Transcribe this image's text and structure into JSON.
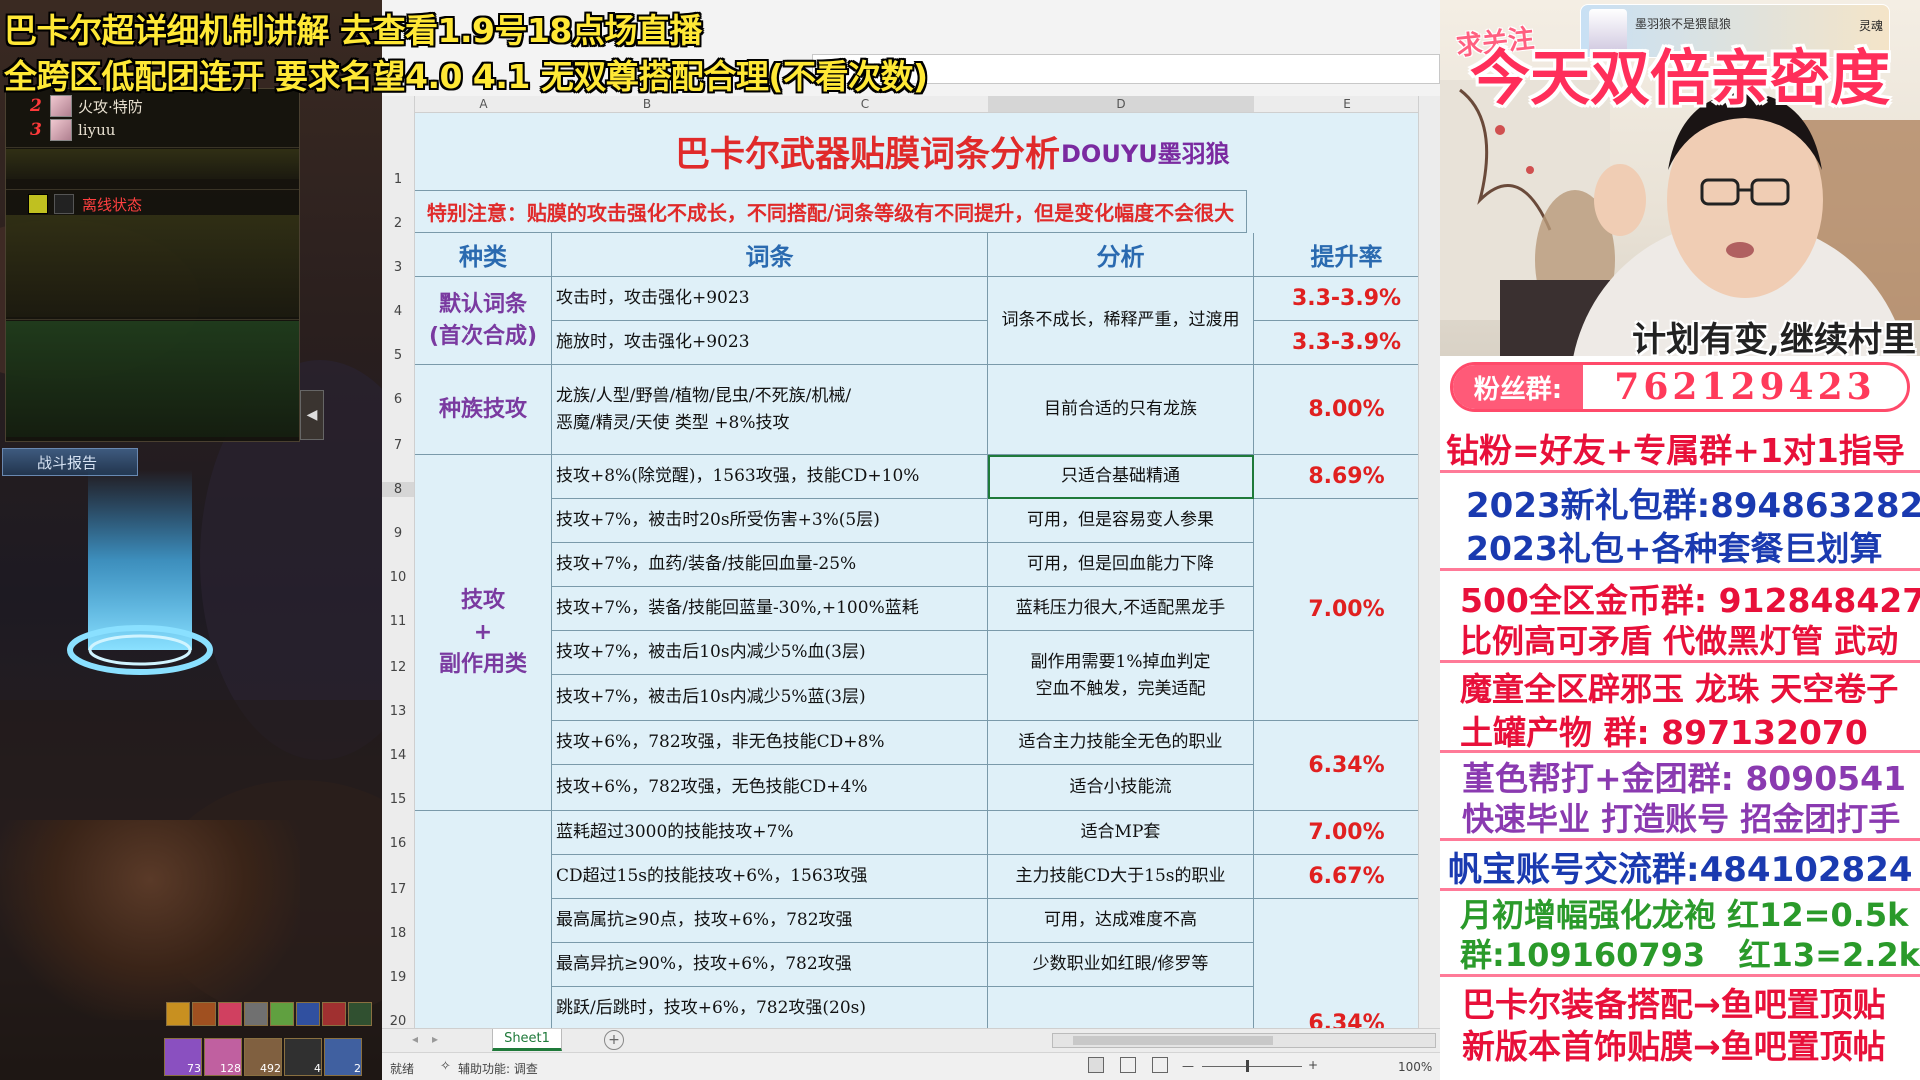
{
  "overlay": {
    "line1": "巴卡尔超详细机制讲解 去查看1.9号18点场直播",
    "line2": "全跨区低配团连开 要求名望4.0 4.1 无双尊搭配合理(不看次数)"
  },
  "game": {
    "party": [
      {
        "num": "2",
        "name": "火攻·特防"
      },
      {
        "num": "3",
        "name": "liyuu"
      }
    ],
    "offline_label": "离线状态",
    "battle_report": "战斗报告",
    "collapse_arrow": "◀",
    "skill_counts": [
      "73",
      "128",
      "492",
      "4",
      "2"
    ]
  },
  "excel": {
    "columns": [
      "A",
      "B",
      "C",
      "D",
      "E"
    ],
    "rows": [
      "1",
      "2",
      "3",
      "4",
      "5",
      "6",
      "7",
      "8",
      "9",
      "10",
      "11",
      "12",
      "13",
      "14",
      "15",
      "16",
      "17",
      "18",
      "19",
      "20"
    ],
    "title": "巴卡尔武器贴膜词条分析",
    "author": "DOUYU墨羽狼",
    "note": "特别注意：贴膜的攻击强化不成长，不同搭配/词条等级有不同提升，但是变化幅度不会很大",
    "headers": {
      "type": "种类",
      "entry": "词条",
      "analysis": "分析",
      "rate": "提升率"
    },
    "types": {
      "default": "默认词条\n(首次合成)",
      "race": "种族技攻",
      "skill_side": "技攻\n+\n副作用类"
    },
    "entries": [
      "攻击时，攻击强化+9023",
      "施放时，攻击强化+9023",
      "龙族/人型/野兽/植物/昆虫/不死族/机械/\n恶魔/精灵/天使  类型 +8%技攻",
      "技攻+8%(除觉醒)，1563攻强，技能CD+10%",
      "技攻+7%，被击时20s所受伤害+3%(5层)",
      "技攻+7%，血药/装备/技能回血量-25%",
      "技攻+7%，装备/技能回蓝量-30%,+100%蓝耗",
      "技攻+7%，被击后10s内减少5%血(3层)",
      "技攻+7%，被击后10s内减少5%蓝(3层)",
      "技攻+6%，782攻强，非无色技能CD+8%",
      "技攻+6%，782攻强，无色技能CD+4%",
      "蓝耗超过3000的技能技攻+7%",
      "CD超过15s的技能技攻+6%，1563攻强",
      "最高属抗≥90点，技攻+6%，782攻强",
      "最高异抗≥90%，技攻+6%，782攻强",
      "跳跃/后跳时，技攻+6%，782攻强(20s)"
    ],
    "analysis": [
      "词条不成长，稀释严重，过渡用",
      "目前合适的只有龙族",
      "只适合基础精通",
      "可用，但是容易变人参果",
      "可用，但是回血能力下降",
      "蓝耗压力很大,不适配黑龙手",
      "副作用需要1%掉血判定\n空血不触发，完美适配",
      "适合主力技能全无色的职业",
      "适合小技能流",
      "适合MP套",
      "主力技能CD大于15s的职业",
      "可用，达成难度不高",
      "少数职业如红眼/修罗等"
    ],
    "rates": [
      "3.3-3.9%",
      "3.3-3.9%",
      "8.00%",
      "8.69%",
      "7.00%",
      "6.34%",
      "7.00%",
      "6.67%",
      "6.34%"
    ],
    "sheet_tab": "Sheet1",
    "add_sheet": "+",
    "status_ready": "就绪",
    "status_accessibility": "辅助功能: 调查",
    "zoom": "100%",
    "zoom_minus": "—",
    "zoom_plus": "+"
  },
  "stream": {
    "banner_text": "墨羽狼不是猥鼠狼",
    "banner_brand": "灵魂",
    "follow": "求关注",
    "big_title": "今天双倍亲密度",
    "subtitle": "计划有变,继续村里",
    "fan_label": "粉丝群:",
    "fan_number": "762129423",
    "promos": [
      "钻粉=好友+专属群+1对1指导",
      "2023新礼包群:894863282",
      "2023礼包+各种套餐巨划算",
      "500全区金币群: 912848427",
      "比例高可矛盾 代做黑灯管 武动",
      "魔童全区辟邪玉 龙珠 天空卷子",
      "土罐产物 群: 897132070",
      "堇色帮打+金团群: 8090541",
      "快速毕业 打造账号 招金团打手",
      "帆宝账号交流群:484102824",
      "月初增幅强化龙袍 红12=0.5k",
      "群:109160793   红13=2.2k起",
      "巴卡尔装备搭配→鱼吧置顶贴",
      "新版本首饰贴膜→鱼吧置顶帖"
    ]
  },
  "colors": {
    "overlay_yellow": "#ffe836",
    "sheet_bg": "#dff0f8",
    "title_red": "#e02a2a",
    "type_purple": "#7a3aa0",
    "header_blue": "#2a6ab0",
    "promo_red": "#e8103a",
    "promo_blue": "#1a3ab0",
    "promo_green": "#2a9a2a",
    "promo_purple": "#8a3ab0"
  }
}
